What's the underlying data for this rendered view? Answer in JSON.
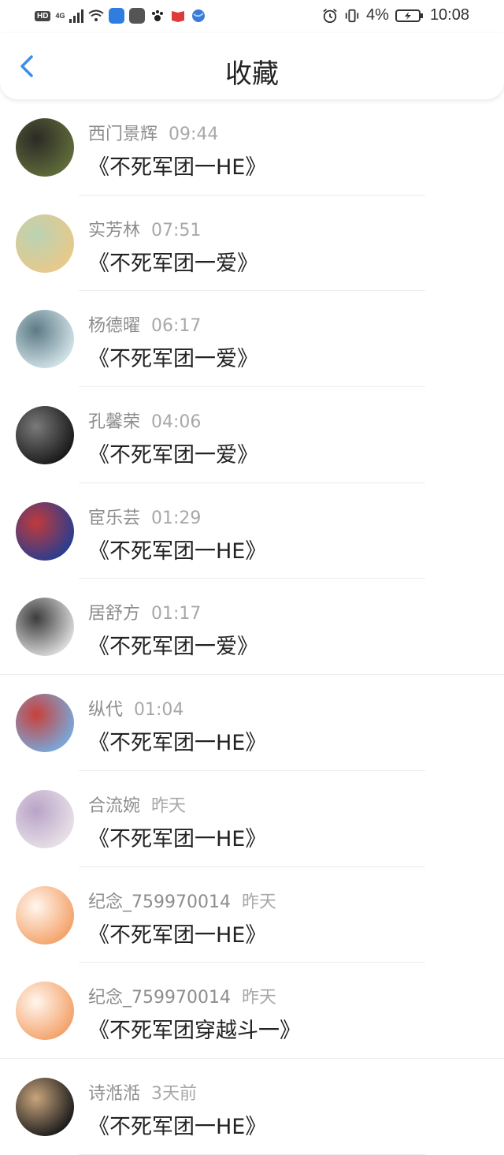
{
  "status_bar": {
    "hd": "HD",
    "network": "4G",
    "battery_percent": "4%",
    "time": "10:08"
  },
  "header": {
    "title": "收藏"
  },
  "items": [
    {
      "user": "西门景辉",
      "time": "09:44",
      "book": "《不死军团一HE》",
      "avatar_colors": [
        "#5f6b3a",
        "#2c2a26"
      ]
    },
    {
      "user": "实芳林",
      "time": "07:51",
      "book": "《不死军团一爱》",
      "avatar_colors": [
        "#e8c98a",
        "#b9d2b4"
      ]
    },
    {
      "user": "杨德曜",
      "time": "06:17",
      "book": "《不死军团一爱》",
      "avatar_colors": [
        "#cfe1e6",
        "#5d7a86"
      ]
    },
    {
      "user": "孔馨荣",
      "time": "04:06",
      "book": "《不死军团一爱》",
      "avatar_colors": [
        "#1a1a1a",
        "#7a7a7a"
      ]
    },
    {
      "user": "宦乐芸",
      "time": "01:29",
      "book": "《不死军团一HE》",
      "avatar_colors": [
        "#2a3d8f",
        "#c23a3a"
      ]
    },
    {
      "user": "居舒方",
      "time": "01:17",
      "book": "《不死军团一爱》",
      "avatar_colors": [
        "#d9d9d9",
        "#3c3c3c"
      ]
    },
    {
      "user": "纵代",
      "time": "01:04",
      "book": "《不死军团一HE》",
      "avatar_colors": [
        "#7aa7d9",
        "#c8413a"
      ]
    },
    {
      "user": "合流婉",
      "time": "昨天",
      "book": "《不死军团一HE》",
      "avatar_colors": [
        "#e7dfe6",
        "#b9a3c8"
      ]
    },
    {
      "user": "纪念_759970014",
      "time": "昨天",
      "book": "《不死军团一HE》",
      "avatar_colors": [
        "#f4a36b",
        "#fff6ee"
      ]
    },
    {
      "user": "纪念_759970014",
      "time": "昨天",
      "book": "《不死军团穿越斗一》",
      "avatar_colors": [
        "#f4a36b",
        "#fff6ee"
      ]
    },
    {
      "user": "诗湉湉",
      "time": "3天前",
      "book": "《不死军团一HE》",
      "avatar_colors": [
        "#1d1d1d",
        "#c9a57c"
      ]
    }
  ],
  "colors": {
    "accent": "#3a8ee6",
    "meta_text": "#8d8d8d",
    "title_text": "#222222"
  }
}
